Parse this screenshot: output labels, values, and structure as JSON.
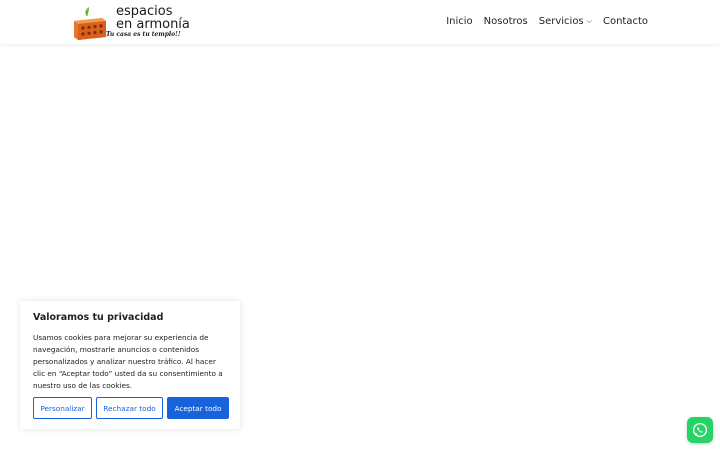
{
  "header": {
    "logo": {
      "line1": "espacios",
      "line2": "en armonía",
      "slogan": "Tu casa es tu templo!!"
    },
    "nav": [
      {
        "label": "Inicio"
      },
      {
        "label": "Nosotros"
      },
      {
        "label": "Servicios",
        "has_dropdown": true
      },
      {
        "label": "Contacto"
      }
    ]
  },
  "cookie_banner": {
    "title": "Valoramos tu privacidad",
    "body": "Usamos cookies para mejorar su experiencia de navegación, mostrarle anuncios o contenidos personalizados y analizar nuestro tráfico. Al hacer clic en “Aceptar todo” usted da su consentimiento a nuestro uso de las cookies.",
    "buttons": {
      "customize": "Personalizar",
      "reject": "Rechazar todo",
      "accept": "Aceptar todo"
    },
    "accent_color": "#1863dc"
  },
  "floating": {
    "whatsapp_icon": "whatsapp-icon",
    "color": "#25d366"
  }
}
